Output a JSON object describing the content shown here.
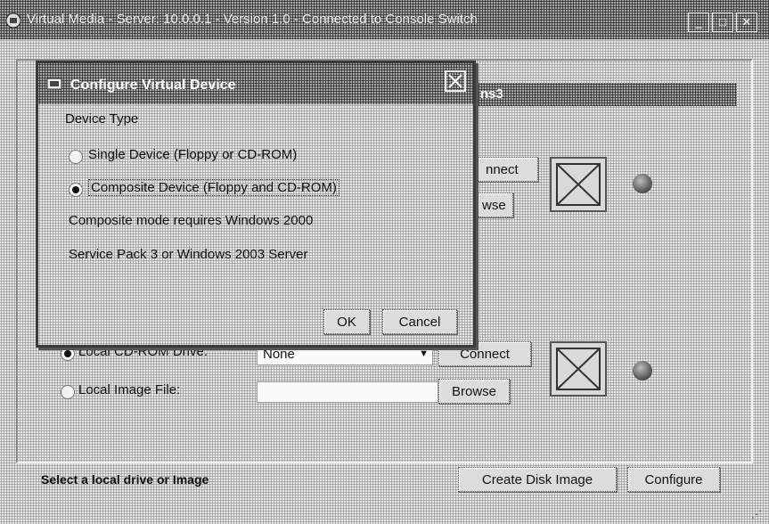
{
  "window": {
    "title": "Virtual Media - Server: 10.0.0.1 - Version 1.0 - Connected to Console Switch",
    "minimize_label": "_",
    "maximize_label": "□",
    "close_label": "✕"
  },
  "panel": {
    "header_tail": "ns3"
  },
  "top_drive": {
    "connect_label": "nnect",
    "browse_label": "wse"
  },
  "bottom_drive": {
    "cdrom_label": "Local CD-ROM Drive:",
    "cdrom_selected": "None",
    "image_label": "Local Image File:",
    "image_value": "",
    "connect_label": "Connect",
    "browse_label": "Browse"
  },
  "footer": {
    "status": "Select a local drive or Image",
    "create_disk_image_label": "Create Disk Image",
    "configure_label": "Configure"
  },
  "dialog": {
    "title": "Configure Virtual Device",
    "group_label": "Device Type",
    "options": [
      {
        "label": "Single Device (Floppy or CD-ROM)",
        "selected": false
      },
      {
        "label": "Composite Device (Floppy and CD-ROM)",
        "selected": true
      }
    ],
    "note_line1": "Composite mode requires Windows 2000",
    "note_line2": "Service Pack 3 or Windows 2003 Server",
    "ok_label": "OK",
    "cancel_label": "Cancel"
  },
  "icons": [
    "app-icon",
    "drive-icon",
    "led-icon",
    "close-icon",
    "dropdown-arrow-icon",
    "resize-grip-icon"
  ],
  "colors": {
    "titlebar": "#6f6f6f",
    "window_bg": "#c8c8c8",
    "field_bg": "#fafafa"
  }
}
